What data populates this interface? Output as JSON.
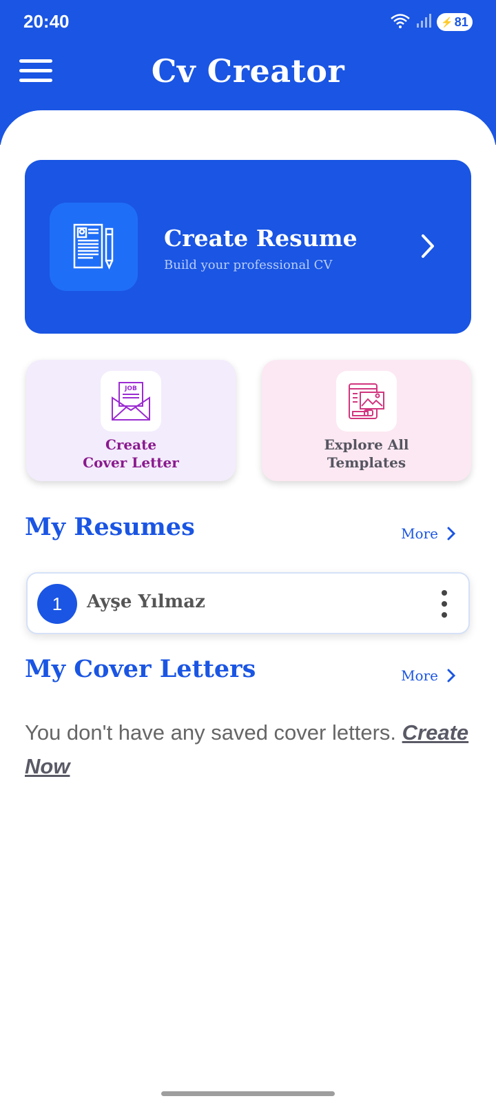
{
  "status_bar": {
    "time": "20:40",
    "battery": "81"
  },
  "app": {
    "title": "Cv Creator"
  },
  "hero": {
    "title": "Create Resume",
    "subtitle": "Build your professional CV"
  },
  "quick_actions": {
    "cover_letter": {
      "line1": "Create",
      "line2": "Cover Letter",
      "icon_badge": "JOB"
    },
    "templates": {
      "line1": "Explore All",
      "line2": "Templates"
    }
  },
  "resumes": {
    "title": "My Resumes",
    "more": "More",
    "items": [
      {
        "index": "1",
        "name": "Ayşe Yılmaz"
      }
    ]
  },
  "cover_letters": {
    "title": "My Cover Letters",
    "more": "More",
    "empty_text": "You don't have any saved cover letters.",
    "create_now": "Create Now"
  },
  "colors": {
    "primary": "#1a55e3",
    "cover_card": "#f3ecfc",
    "templates_card": "#fce8f2"
  }
}
